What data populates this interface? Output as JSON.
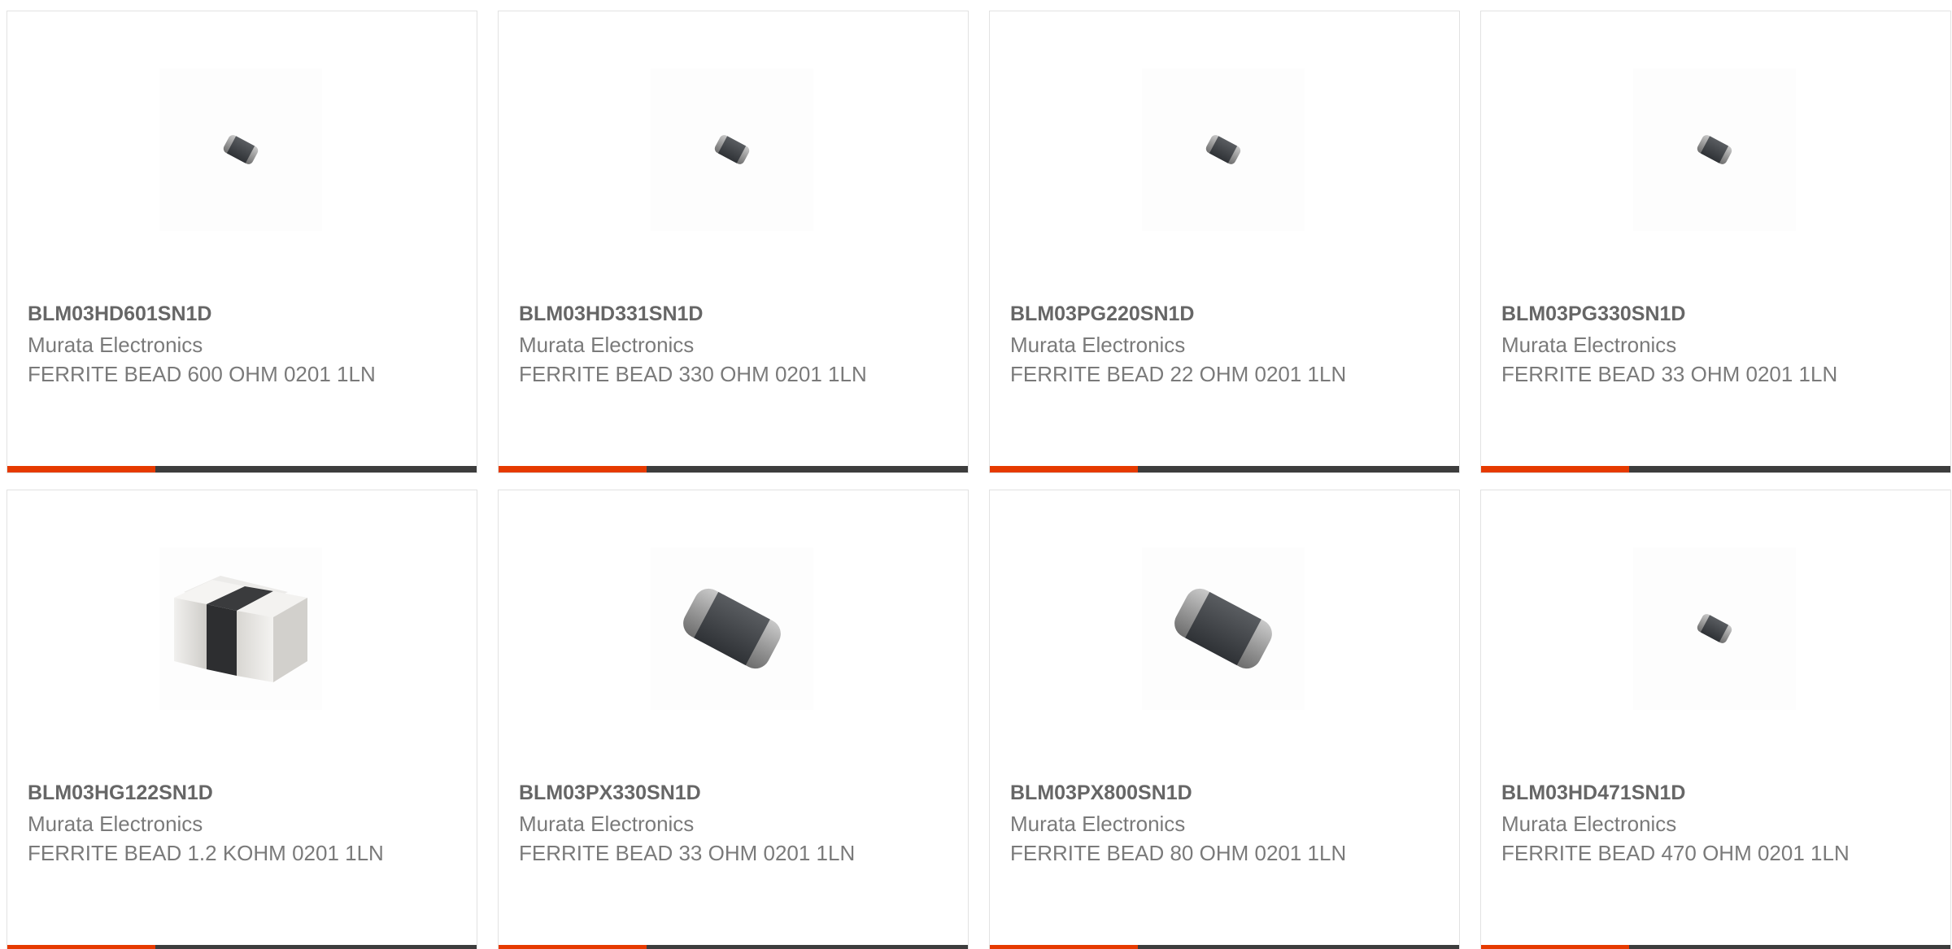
{
  "colors": {
    "accent": "#e63a00",
    "bar_dark": "#3d3d3d",
    "text": "#7a7a7a",
    "title": "#666666"
  },
  "products": [
    {
      "part_number": "BLM03HD601SN1D",
      "manufacturer": "Murata Electronics",
      "description": "FERRITE BEAD 600 OHM 0201 1LN",
      "icon": "ferrite-bead-small-icon"
    },
    {
      "part_number": "BLM03HD331SN1D",
      "manufacturer": "Murata Electronics",
      "description": "FERRITE BEAD 330 OHM 0201 1LN",
      "icon": "ferrite-bead-small-icon"
    },
    {
      "part_number": "BLM03PG220SN1D",
      "manufacturer": "Murata Electronics",
      "description": "FERRITE BEAD 22 OHM 0201 1LN",
      "icon": "ferrite-bead-small-icon"
    },
    {
      "part_number": "BLM03PG330SN1D",
      "manufacturer": "Murata Electronics",
      "description": "FERRITE BEAD 33 OHM 0201 1LN",
      "icon": "ferrite-bead-small-icon"
    },
    {
      "part_number": "BLM03HG122SN1D",
      "manufacturer": "Murata Electronics",
      "description": "FERRITE BEAD 1.2 KOHM 0201 1LN",
      "icon": "ferrite-bead-block-icon"
    },
    {
      "part_number": "BLM03PX330SN1D",
      "manufacturer": "Murata Electronics",
      "description": "FERRITE BEAD 33 OHM 0201 1LN",
      "icon": "ferrite-bead-large-icon"
    },
    {
      "part_number": "BLM03PX800SN1D",
      "manufacturer": "Murata Electronics",
      "description": "FERRITE BEAD 80 OHM 0201 1LN",
      "icon": "ferrite-bead-large-icon"
    },
    {
      "part_number": "BLM03HD471SN1D",
      "manufacturer": "Murata Electronics",
      "description": "FERRITE BEAD 470 OHM 0201 1LN",
      "icon": "ferrite-bead-small-icon"
    }
  ]
}
